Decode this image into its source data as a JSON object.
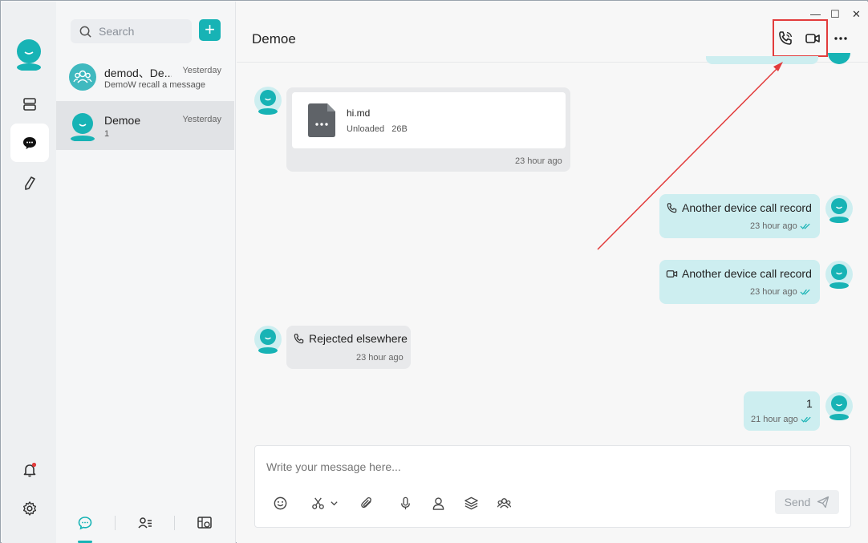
{
  "colors": {
    "accent": "#17b3b5",
    "outgoing_bubble": "#cdeef0",
    "incoming_bubble": "#e8e9eb",
    "annotation": "#e23c3c"
  },
  "rail": {
    "items": [
      {
        "name": "workspace",
        "icon": "server-icon"
      },
      {
        "name": "chat",
        "icon": "chat-bubble-icon"
      },
      {
        "name": "discover",
        "icon": "pen-icon"
      }
    ],
    "bottom": [
      {
        "name": "notifications",
        "icon": "bell-icon"
      },
      {
        "name": "settings",
        "icon": "gear-icon"
      }
    ]
  },
  "search": {
    "placeholder": "Search",
    "add_label": "+"
  },
  "conversations": [
    {
      "name": "demod、De...",
      "time": "Yesterday",
      "preview": "DemoW recall a message",
      "type": "group"
    },
    {
      "name": "Demoe",
      "time": "Yesterday",
      "preview": "1",
      "type": "user",
      "selected": true
    }
  ],
  "bottom_tabs": [
    {
      "icon": "chat-tab-icon"
    },
    {
      "icon": "contacts-icon"
    },
    {
      "icon": "workbench-icon"
    }
  ],
  "chat": {
    "title": "Demoe",
    "window_controls": {
      "minimize": "—",
      "maximize": "☐",
      "close": "✕"
    },
    "messages": [
      {
        "direction": "in",
        "kind": "file",
        "file_name": "hi.md",
        "status": "Unloaded",
        "size": "26B",
        "time": "23 hour ago"
      },
      {
        "direction": "out",
        "kind": "call",
        "icon": "phone-icon",
        "text": "Another device call record",
        "time": "23 hour ago"
      },
      {
        "direction": "out",
        "kind": "call",
        "icon": "video-icon",
        "text": "Another device call record",
        "time": "23 hour ago"
      },
      {
        "direction": "in",
        "kind": "call",
        "icon": "phone-icon",
        "text": "Rejected elsewhere",
        "time": "23 hour ago"
      },
      {
        "direction": "out",
        "kind": "text",
        "text": "1",
        "time": "21 hour ago"
      }
    ],
    "composer": {
      "placeholder": "Write your message here...",
      "send_label": "Send"
    }
  }
}
